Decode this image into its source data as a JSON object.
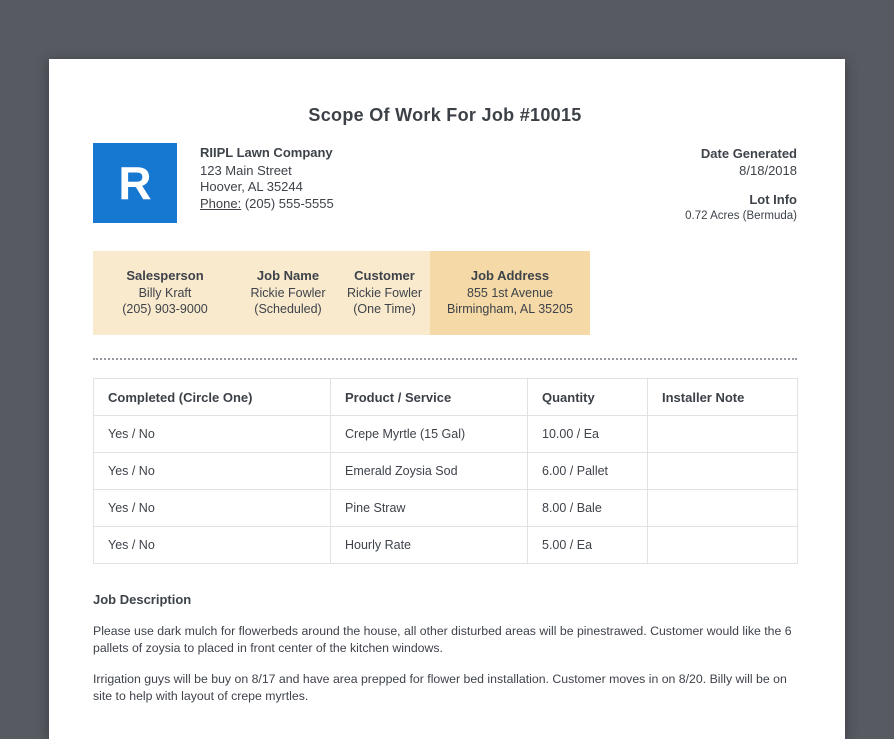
{
  "page": {
    "title": "Scope Of Work For Job #10015"
  },
  "company": {
    "logo_letter": "R",
    "name": "RIIPL Lawn Company",
    "address_line1": "123 Main Street",
    "address_line2": "Hoover, AL 35244",
    "phone_label": "Phone:",
    "phone": "(205) 555-5555"
  },
  "meta": {
    "date_generated_label": "Date Generated",
    "date_generated": "8/18/2018",
    "lot_info_label": "Lot Info",
    "lot_info": "0.72 Acres (Bermuda)"
  },
  "job_summary": {
    "columns": [
      {
        "label": "Salesperson",
        "line1": "Billy Kraft",
        "line2": "(205) 903-9000",
        "highlight": false
      },
      {
        "label": "Job Name",
        "line1": "Rickie Fowler",
        "line2": "(Scheduled)",
        "highlight": false
      },
      {
        "label": "Customer",
        "line1": "Rickie Fowler",
        "line2": "(One Time)",
        "highlight": false
      },
      {
        "label": "Job Address",
        "line1": "855 1st Avenue",
        "line2": "Birmingham, AL 35205",
        "highlight": true
      }
    ]
  },
  "work_table": {
    "headers": [
      "Completed (Circle One)",
      "Product / Service",
      "Quantity",
      "Installer Note"
    ],
    "rows": [
      [
        "Yes / No",
        "Crepe Myrtle (15 Gal)",
        "10.00 / Ea",
        ""
      ],
      [
        "Yes / No",
        "Emerald Zoysia Sod",
        "6.00 / Pallet",
        ""
      ],
      [
        "Yes / No",
        "Pine Straw",
        "8.00 / Bale",
        ""
      ],
      [
        "Yes / No",
        "Hourly Rate",
        "5.00 / Ea",
        ""
      ]
    ]
  },
  "job_description": {
    "heading": "Job Description",
    "paragraphs": [
      "Please use dark mulch for flowerbeds around the house, all other disturbed areas will be pinestrawed. Customer would like the 6 pallets of zoysia to placed in front center of the kitchen windows.",
      "Irrigation guys will be buy on 8/17 and have area prepped for flower bed installation. Customer moves in on 8/20. Billy will be on site to help with layout of crepe myrtles."
    ]
  },
  "colors": {
    "accent_blue": "#1778d2",
    "band_light": "#f9e9cd",
    "band_highlight": "#f5d9a6",
    "viewer_background": "#585a62"
  }
}
